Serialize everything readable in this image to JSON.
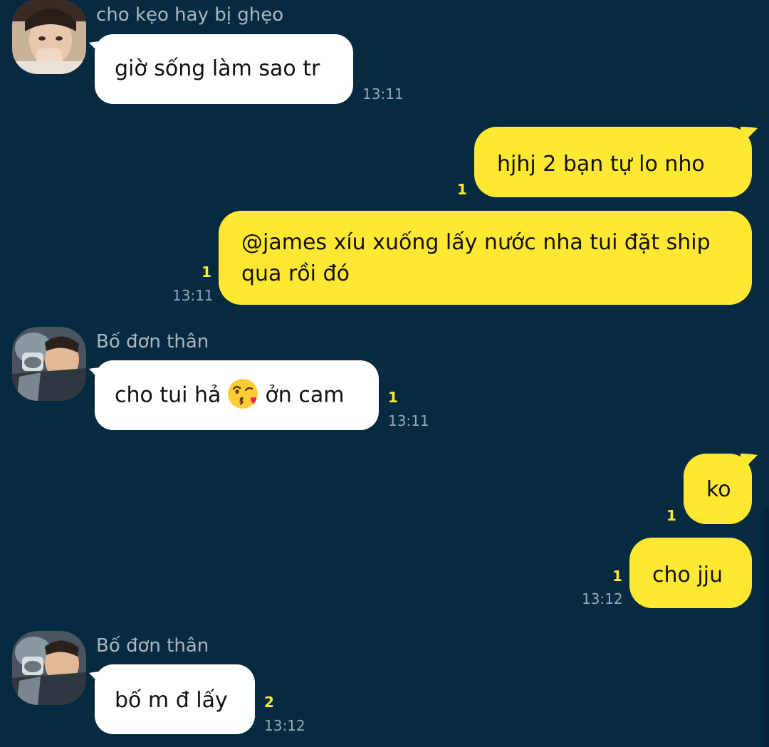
{
  "colors": {
    "background": "#062b41",
    "incoming_bubble": "#ffffff",
    "outgoing_bubble": "#ffe831",
    "unread_count": "#ffe831",
    "sender_name": "#a8b7c2",
    "timestamp": "#97a9b5"
  },
  "messages": [
    {
      "sender": "cho kẹo hay bị ghẹo",
      "text": "giờ sống làm sao tr",
      "time": "13:11"
    },
    {
      "text": "hjhj 2 bạn tự lo nho",
      "unread": "1"
    },
    {
      "text_line1": "@james xíu xuống lấy nước nha tui đặt ship",
      "text_line2": "qua rồi đó",
      "unread": "1",
      "time": "13:11"
    },
    {
      "sender": "Bố đơn thân",
      "text_before": "cho tui hả",
      "emoji": "kissing-heart-emoji",
      "text_after": "ởn cam",
      "unread": "1",
      "time": "13:11"
    },
    {
      "text": "ko",
      "unread": "1"
    },
    {
      "text": "cho jju",
      "unread": "1",
      "time": "13:12"
    },
    {
      "sender": "Bố đơn thân",
      "text": "bố m đ lấy",
      "unread": "2",
      "time": "13:12"
    }
  ]
}
